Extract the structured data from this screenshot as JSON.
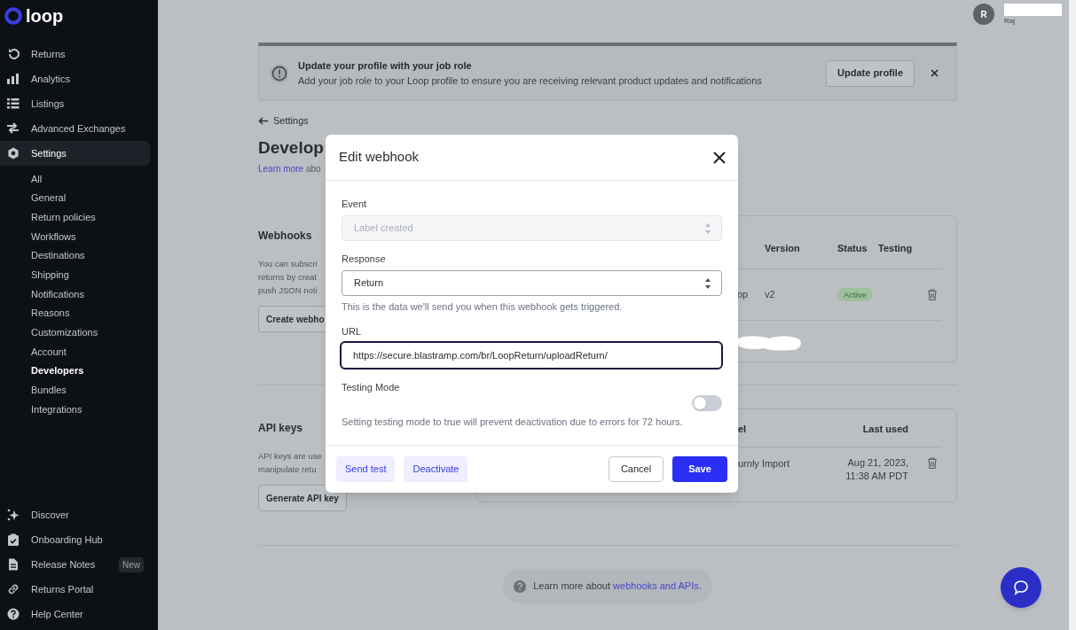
{
  "sidebar": {
    "logo": "loop",
    "nav": [
      {
        "label": "Returns",
        "selected": false
      },
      {
        "label": "Analytics",
        "selected": false
      },
      {
        "label": "Listings",
        "selected": false
      },
      {
        "label": "Advanced Exchanges",
        "selected": false
      },
      {
        "label": "Settings",
        "selected": true
      }
    ],
    "settings_items": [
      {
        "label": "All",
        "selected": false
      },
      {
        "label": "General",
        "selected": false
      },
      {
        "label": "Return policies",
        "selected": false
      },
      {
        "label": "Workflows",
        "selected": false
      },
      {
        "label": "Destinations",
        "selected": false
      },
      {
        "label": "Shipping",
        "selected": false
      },
      {
        "label": "Notifications",
        "selected": false
      },
      {
        "label": "Reasons",
        "selected": false
      },
      {
        "label": "Customizations",
        "selected": false
      },
      {
        "label": "Account",
        "selected": false
      },
      {
        "label": "Developers",
        "selected": true
      },
      {
        "label": "Bundles",
        "selected": false
      },
      {
        "label": "Integrations",
        "selected": false
      }
    ],
    "footer_items": [
      {
        "label": "Discover"
      },
      {
        "label": "Onboarding Hub"
      },
      {
        "label": "Release Notes",
        "badge": "New"
      },
      {
        "label": "Returns Portal"
      },
      {
        "label": "Help Center"
      }
    ]
  },
  "user": {
    "avatar": "R",
    "name": "Raj"
  },
  "banner": {
    "title": "Update your profile with your job role",
    "text": "Add your job role to your Loop profile to ensure you are receiving relevant product updates and notifications",
    "button": "Update profile"
  },
  "back_link": "Settings",
  "page_title": "Develop",
  "learn_more": {
    "link": "Learn more",
    "rest": "abo"
  },
  "webhooks": {
    "title": "Webhooks",
    "description_lines": [
      "You can subscri",
      "returns by creat",
      "push JSON noti"
    ],
    "button": "Create webho",
    "table": {
      "columns": [
        "Version",
        "Status",
        "Testing"
      ],
      "rows": [
        {
          "column_1": "op",
          "version": "v2",
          "status": "Active"
        }
      ]
    }
  },
  "api_keys": {
    "title": "API keys",
    "description_lines": [
      "API keys are use",
      "manipulate retu"
    ],
    "button": "Generate API key",
    "table": {
      "columns": [
        "el",
        "Last used"
      ],
      "rows": [
        {
          "column_1": "urnly Import",
          "last_used": "Aug 21, 2023, 11:38 AM PDT"
        }
      ]
    }
  },
  "help": {
    "text": "Learn more about",
    "link": "webhooks and APIs",
    "tail": "."
  },
  "modal": {
    "title": "Edit webhook",
    "fields": [
      {
        "kind": "select",
        "label": "Event",
        "value": "Label created",
        "disabled": true
      },
      {
        "kind": "select",
        "label": "Response",
        "value": "Return",
        "disabled": false,
        "help": "This is the data we'll send you when this webhook gets triggered."
      },
      {
        "kind": "text",
        "label": "URL",
        "value": "https://secure.blastramp.com/br/LoopReturn/uploadReturn/",
        "focused": true
      },
      {
        "kind": "toggle",
        "label": "Testing Mode",
        "on": false,
        "help": "Setting testing mode to true will prevent deactivation due to errors for 72 hours."
      }
    ],
    "buttons": [
      {
        "label": "Send test",
        "kind": "secondary"
      },
      {
        "label": "Deactivate",
        "kind": "secondary"
      },
      {
        "label": "Cancel",
        "kind": "outline"
      },
      {
        "label": "Save",
        "kind": "primary"
      }
    ]
  }
}
